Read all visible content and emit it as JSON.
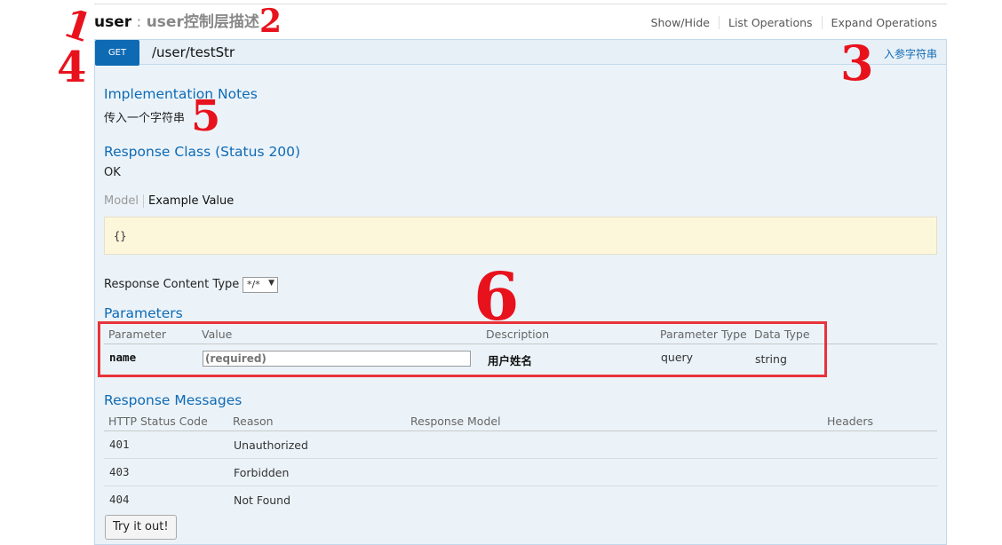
{
  "header": {
    "resource": "user",
    "separator": " : ",
    "description": "user控制层描述",
    "ops": [
      "Show/Hide",
      "List Operations",
      "Expand Operations"
    ]
  },
  "operation": {
    "verb": "GET",
    "path": "/user/testStr",
    "summary": "入参字符串"
  },
  "impl": {
    "title": "Implementation Notes",
    "notes": "传入一个字符串"
  },
  "response_class": {
    "title": "Response Class (Status 200)",
    "status_text": "OK",
    "tab_model": "Model",
    "tab_example": "Example Value",
    "example": "{}"
  },
  "content_type": {
    "label": "Response Content Type",
    "selected": "*/*"
  },
  "parameters": {
    "title": "Parameters",
    "columns": [
      "Parameter",
      "Value",
      "Description",
      "Parameter Type",
      "Data Type"
    ],
    "rows": [
      {
        "name": "name",
        "placeholder": "(required)",
        "description": "用户姓名",
        "param_type": "query",
        "data_type": "string"
      }
    ]
  },
  "responses": {
    "title": "Response Messages",
    "columns": [
      "HTTP Status Code",
      "Reason",
      "Response Model",
      "Headers"
    ],
    "rows": [
      {
        "code": "401",
        "reason": "Unauthorized"
      },
      {
        "code": "403",
        "reason": "Forbidden"
      },
      {
        "code": "404",
        "reason": "Not Found"
      }
    ]
  },
  "try_button": "Try it out!",
  "annotations": [
    "1",
    "2",
    "3",
    "4",
    "5",
    "6"
  ],
  "colors": {
    "verb_get": "#0f6ab4",
    "panel_bg": "#ebf3f9",
    "annotation_red": "#e8121d",
    "example_bg": "#fcf6db"
  }
}
